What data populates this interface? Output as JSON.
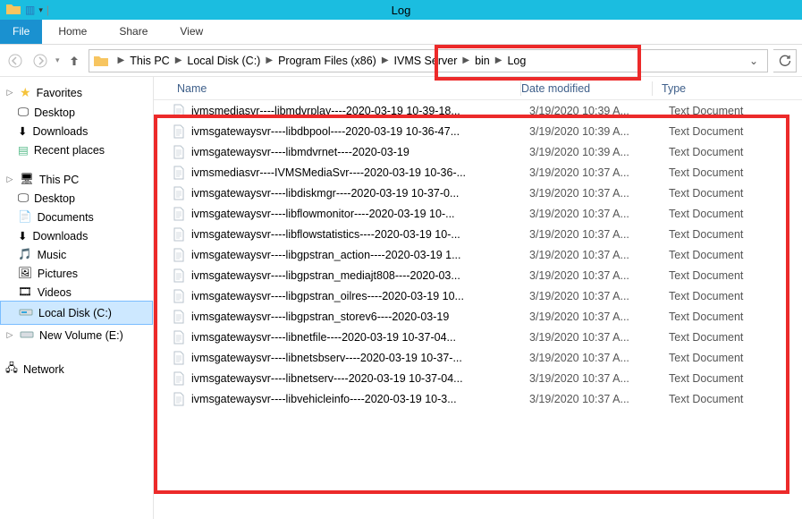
{
  "window": {
    "title": "Log"
  },
  "ribbon": {
    "file": "File",
    "tabs": [
      "Home",
      "Share",
      "View"
    ]
  },
  "breadcrumbs": {
    "items": [
      "This PC",
      "Local Disk (C:)",
      "Program Files (x86)",
      "IVMS Server",
      "bin",
      "Log"
    ]
  },
  "sidebar": {
    "favorites": {
      "label": "Favorites",
      "items": [
        "Desktop",
        "Downloads",
        "Recent places"
      ]
    },
    "thispc": {
      "label": "This PC",
      "items": [
        "Desktop",
        "Documents",
        "Downloads",
        "Music",
        "Pictures",
        "Videos",
        "Local Disk (C:)",
        "New Volume (E:)"
      ]
    },
    "network": {
      "label": "Network"
    }
  },
  "columns": {
    "name": "Name",
    "date": "Date modified",
    "type": "Type"
  },
  "files": [
    {
      "name": "ivmsmediasvr----libmdvrplay----2020-03-19 10-39-18...",
      "date": "3/19/2020 10:39 A...",
      "type": "Text Document"
    },
    {
      "name": "ivmsgatewaysvr----libdbpool----2020-03-19 10-36-47...",
      "date": "3/19/2020 10:39 A...",
      "type": "Text Document"
    },
    {
      "name": "ivmsgatewaysvr----libmdvrnet----2020-03-19",
      "date": "3/19/2020 10:39 A...",
      "type": "Text Document"
    },
    {
      "name": "ivmsmediasvr----IVMSMediaSvr----2020-03-19 10-36-...",
      "date": "3/19/2020 10:37 A...",
      "type": "Text Document"
    },
    {
      "name": "ivmsgatewaysvr----libdiskmgr----2020-03-19 10-37-0...",
      "date": "3/19/2020 10:37 A...",
      "type": "Text Document"
    },
    {
      "name": "ivmsgatewaysvr----libflowmonitor----2020-03-19 10-...",
      "date": "3/19/2020 10:37 A...",
      "type": "Text Document"
    },
    {
      "name": "ivmsgatewaysvr----libflowstatistics----2020-03-19 10-...",
      "date": "3/19/2020 10:37 A...",
      "type": "Text Document"
    },
    {
      "name": "ivmsgatewaysvr----libgpstran_action----2020-03-19 1...",
      "date": "3/19/2020 10:37 A...",
      "type": "Text Document"
    },
    {
      "name": "ivmsgatewaysvr----libgpstran_mediajt808----2020-03...",
      "date": "3/19/2020 10:37 A...",
      "type": "Text Document"
    },
    {
      "name": "ivmsgatewaysvr----libgpstran_oilres----2020-03-19 10...",
      "date": "3/19/2020 10:37 A...",
      "type": "Text Document"
    },
    {
      "name": "ivmsgatewaysvr----libgpstran_storev6----2020-03-19",
      "date": "3/19/2020 10:37 A...",
      "type": "Text Document"
    },
    {
      "name": "ivmsgatewaysvr----libnetfile----2020-03-19 10-37-04...",
      "date": "3/19/2020 10:37 A...",
      "type": "Text Document"
    },
    {
      "name": "ivmsgatewaysvr----libnetsbserv----2020-03-19 10-37-...",
      "date": "3/19/2020 10:37 A...",
      "type": "Text Document"
    },
    {
      "name": "ivmsgatewaysvr----libnetserv----2020-03-19 10-37-04...",
      "date": "3/19/2020 10:37 A...",
      "type": "Text Document"
    },
    {
      "name": "ivmsgatewaysvr----libvehicleinfo----2020-03-19 10-3...",
      "date": "3/19/2020 10:37 A...",
      "type": "Text Document"
    }
  ]
}
